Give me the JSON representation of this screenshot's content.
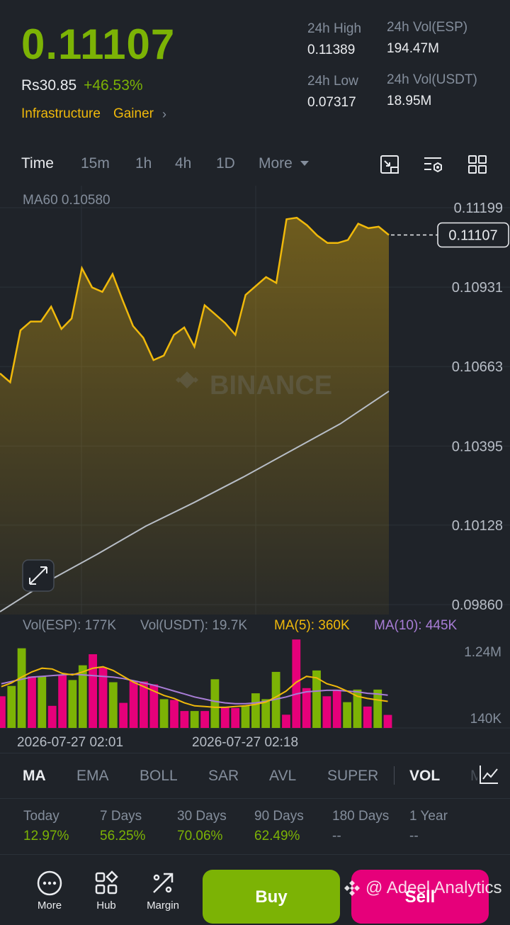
{
  "header": {
    "price": "0.11107",
    "fiat_price": "Rs30.85",
    "change": "+46.53%",
    "tag_1": "Infrastructure",
    "tag_2": "Gainer",
    "high_label": "24h High",
    "high_value": "0.11389",
    "low_label": "24h Low",
    "low_value": "0.07317",
    "vol_esp_label": "24h Vol(ESP)",
    "vol_esp_value": "194.47M",
    "vol_usdt_label": "24h Vol(USDT)",
    "vol_usdt_value": "18.95M"
  },
  "timeframes": {
    "items": [
      "Time",
      "15m",
      "1h",
      "4h",
      "1D",
      "More"
    ],
    "active": "Time"
  },
  "chart": {
    "ma60_legend": "MA60 0.10580",
    "current_price_tag": "0.11107",
    "watermark": "BINANCE",
    "vol_esp_legend": "Vol(ESP): 177K",
    "vol_usdt_legend": "Vol(USDT): 19.7K",
    "ma5_legend": "MA(5): 360K",
    "ma10_legend": "MA(10): 445K",
    "vol_axis_top": "1.24M",
    "vol_axis_bottom": "140K",
    "time_label_1": "2026-07-27 02:01",
    "time_label_2": "2026-07-27 02:18"
  },
  "chart_data": {
    "type": "area",
    "y_ticks": [
      "0.11199",
      "0.10931",
      "0.10663",
      "0.10395",
      "0.10128",
      "0.09860"
    ],
    "ylim": [
      0.0986,
      0.11199
    ],
    "price_series": {
      "name": "Price",
      "values": [
        0.1064,
        0.1061,
        0.10785,
        0.10815,
        0.10815,
        0.10865,
        0.1079,
        0.10825,
        0.10995,
        0.1093,
        0.10915,
        0.10975,
        0.10885,
        0.108,
        0.1076,
        0.10685,
        0.107,
        0.1077,
        0.10795,
        0.1073,
        0.1087,
        0.1084,
        0.1081,
        0.1077,
        0.10905,
        0.10935,
        0.10965,
        0.10945,
        0.1116,
        0.11165,
        0.1114,
        0.11105,
        0.1108,
        0.1108,
        0.1109,
        0.11145,
        0.1113,
        0.11135,
        0.11107
      ]
    },
    "ma60_series": {
      "name": "MA60",
      "values": [
        0.0986,
        0.0994,
        0.1003,
        0.10125,
        0.10205,
        0.1029,
        0.1038,
        0.1047,
        0.1058
      ]
    },
    "volume": {
      "ylim": [
        0,
        1240000
      ],
      "colors": [
        "pink",
        "green",
        "green",
        "pink",
        "green",
        "pink",
        "pink",
        "green",
        "green",
        "pink",
        "pink",
        "green",
        "pink",
        "pink",
        "pink",
        "pink",
        "green",
        "pink",
        "pink",
        "green",
        "pink",
        "green",
        "pink",
        "pink",
        "green",
        "green",
        "green",
        "green",
        "pink",
        "pink",
        "pink",
        "green",
        "pink",
        "pink",
        "green",
        "green",
        "pink",
        "green",
        "pink"
      ],
      "values": [
        430000,
        570000,
        1080000,
        700000,
        700000,
        300000,
        720000,
        650000,
        850000,
        1000000,
        820000,
        620000,
        340000,
        640000,
        630000,
        590000,
        390000,
        380000,
        230000,
        230000,
        230000,
        660000,
        280000,
        270000,
        300000,
        470000,
        390000,
        760000,
        180000,
        1200000,
        540000,
        780000,
        430000,
        520000,
        350000,
        520000,
        290000,
        520000,
        177000
      ],
      "ma5": [
        560000,
        610000,
        690000,
        760000,
        810000,
        800000,
        740000,
        720000,
        760000,
        810000,
        830000,
        780000,
        700000,
        620000,
        560000,
        500000,
        440000,
        400000,
        340000,
        300000,
        290000,
        280000,
        280000,
        290000,
        300000,
        320000,
        350000,
        420000,
        500000,
        620000,
        700000,
        680000,
        600000,
        560000,
        500000,
        430000,
        400000,
        380000,
        360000
      ],
      "ma10": [
        600000,
        630000,
        660000,
        690000,
        700000,
        710000,
        720000,
        730000,
        720000,
        710000,
        700000,
        690000,
        670000,
        640000,
        610000,
        580000,
        540000,
        500000,
        460000,
        420000,
        390000,
        360000,
        340000,
        330000,
        330000,
        340000,
        360000,
        390000,
        420000,
        460000,
        490000,
        500000,
        510000,
        510000,
        500000,
        490000,
        470000,
        460000,
        445000
      ]
    }
  },
  "indicators": {
    "items": [
      "MA",
      "EMA",
      "BOLL",
      "SAR",
      "AVL",
      "SUPER",
      "VOL",
      "M"
    ],
    "active": [
      "MA",
      "VOL"
    ]
  },
  "performance": [
    {
      "label": "Today",
      "value": "12.97%"
    },
    {
      "label": "7 Days",
      "value": "56.25%"
    },
    {
      "label": "30 Days",
      "value": "70.06%"
    },
    {
      "label": "90 Days",
      "value": "62.49%"
    },
    {
      "label": "180 Days",
      "value": "--"
    },
    {
      "label": "1 Year",
      "value": "--"
    }
  ],
  "bottom": {
    "more_label": "More",
    "hub_label": "Hub",
    "margin_label": "Margin",
    "buy_label": "Buy",
    "sell_label": "Sell",
    "watermark": "@ Adeel Analytics"
  },
  "colors": {
    "up": "#7cb305",
    "down": "#e6007a",
    "accent": "#f0b90b",
    "ma10": "#a87dd6",
    "background": "#1f2329"
  }
}
